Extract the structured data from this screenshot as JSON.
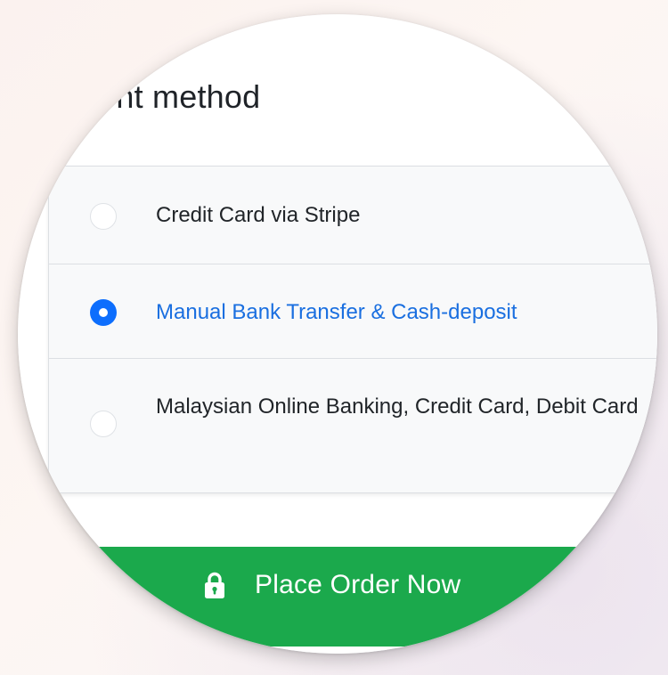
{
  "heading": "ment method",
  "payment_options": [
    {
      "label": "Credit Card via Stripe",
      "selected": false
    },
    {
      "label": "Manual Bank Transfer & Cash-deposit",
      "selected": true
    },
    {
      "label": "Malaysian Online Banking, Credit Card, Debit Card",
      "selected": false
    }
  ],
  "button": {
    "label": "Place Order Now",
    "icon": "lock-icon"
  },
  "colors": {
    "accent_blue": "#0d6efd",
    "selected_text": "#1a6fe0",
    "button_green": "#1ba94c"
  }
}
